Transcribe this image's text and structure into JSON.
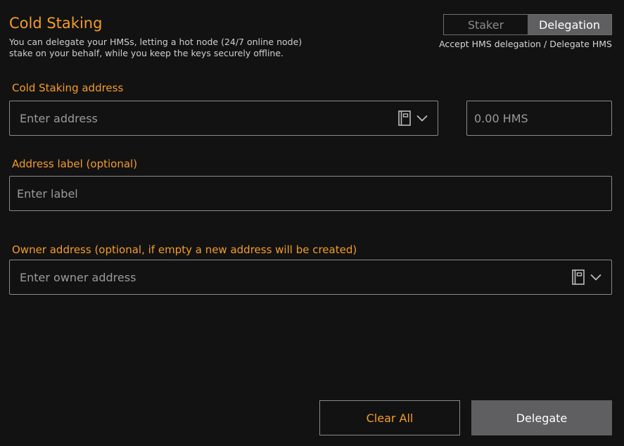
{
  "header": {
    "title": "Cold Staking",
    "subtitle": "You can delegate your HMSs, letting a hot node (24/7 online node) stake on your behalf, while you keep the keys securely offline."
  },
  "mode_toggle": {
    "options": [
      "Staker",
      "Delegation"
    ],
    "selected": "Delegation",
    "caption": "Accept HMS delegation / Delegate HMS"
  },
  "form": {
    "cold_staking_address": {
      "label": "Cold Staking address",
      "placeholder": "Enter address",
      "value": ""
    },
    "amount": {
      "value": "0.00 HMS"
    },
    "address_label": {
      "label": "Address label (optional)",
      "placeholder": "Enter label",
      "value": ""
    },
    "owner_address": {
      "label": "Owner address (optional, if empty a new address will be created)",
      "placeholder": "Enter owner address",
      "value": ""
    }
  },
  "actions": {
    "clear_label": "Clear All",
    "delegate_label": "Delegate"
  },
  "icons": {
    "address_book": "address-book-icon",
    "dropdown": "chevron-down-icon"
  },
  "colors": {
    "accent": "#f39c2a",
    "background": "#121212",
    "selected_segment": "#5f5f62",
    "border": "#8a8a8a"
  }
}
